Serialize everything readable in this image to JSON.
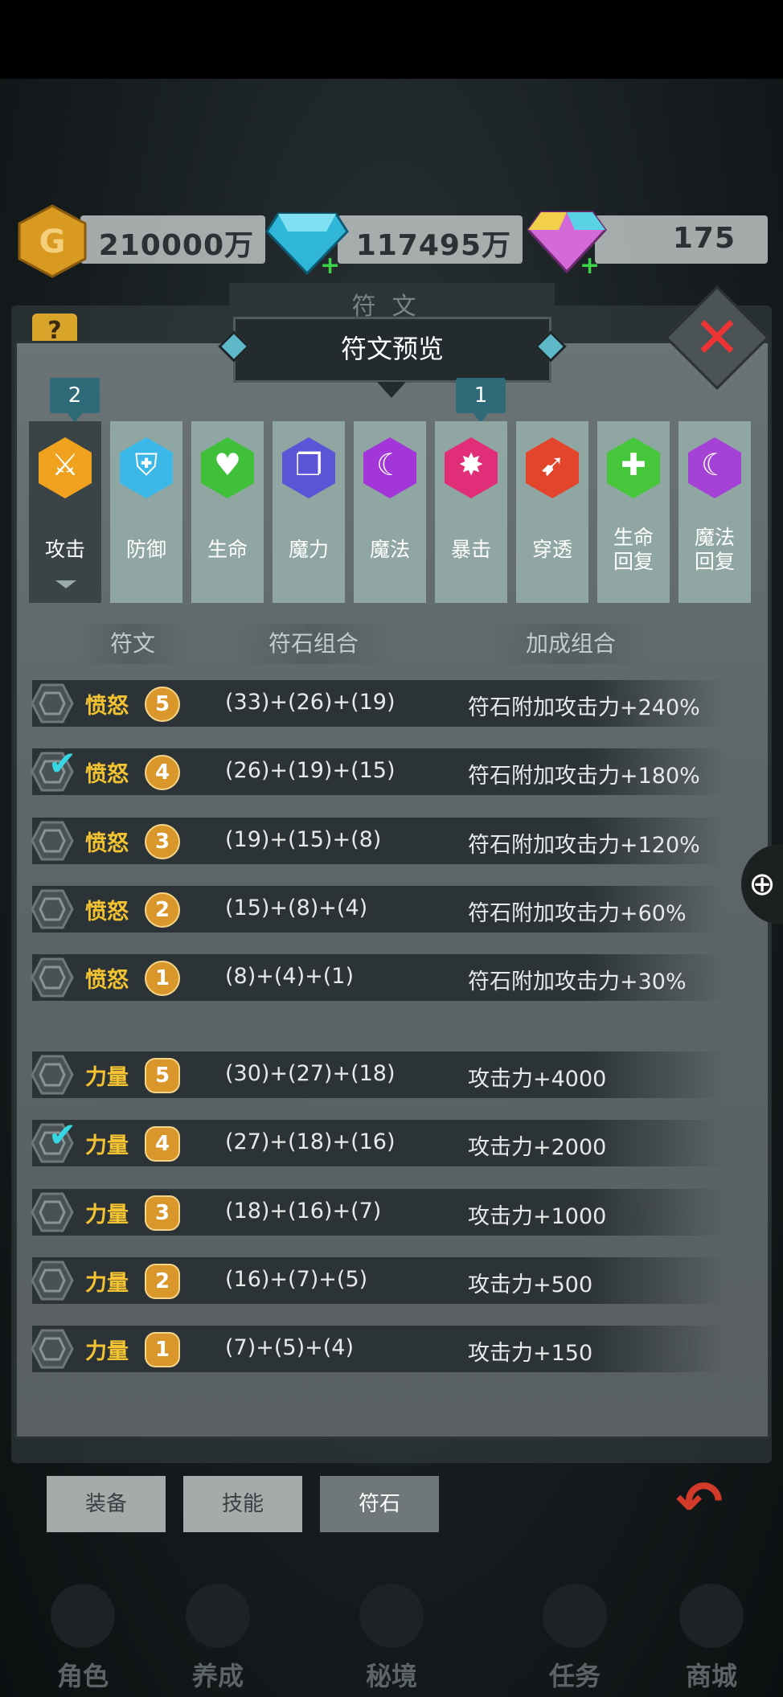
{
  "currency": {
    "gold": "210000万",
    "gems": "117495万",
    "crystals": "175"
  },
  "background": {
    "panel_title": "符文",
    "help": "?"
  },
  "dialog": {
    "title": "符文预览",
    "close_icon": "close-icon"
  },
  "tabs": [
    {
      "label": "攻击",
      "badge": "2",
      "color": "#f0a21e",
      "icon": "sword-icon",
      "glyph": "⚔"
    },
    {
      "label": "防御",
      "badge": "",
      "color": "#3bb8e8",
      "icon": "shield-icon",
      "glyph": "⛨"
    },
    {
      "label": "生命",
      "badge": "",
      "color": "#3fbf3a",
      "icon": "heart-icon",
      "glyph": "♥"
    },
    {
      "label": "魔力",
      "badge": "",
      "color": "#5a55d6",
      "icon": "book-icon",
      "glyph": "❐"
    },
    {
      "label": "魔法",
      "badge": "",
      "color": "#a336d8",
      "icon": "moon-icon",
      "glyph": "☾"
    },
    {
      "label": "暴击",
      "badge": "1",
      "color": "#e02f78",
      "icon": "burst-icon",
      "glyph": "✸"
    },
    {
      "label": "穿透",
      "badge": "",
      "color": "#e2452c",
      "icon": "pierce-icon",
      "glyph": "➹"
    },
    {
      "label": "生命回复",
      "label_line1": "生命",
      "label_line2": "回复",
      "badge": "",
      "color": "#46c63a",
      "icon": "heart-plus-icon",
      "glyph": "✚"
    },
    {
      "label": "魔法回复",
      "label_line1": "魔法",
      "label_line2": "回复",
      "badge": "",
      "color": "#a442d6",
      "icon": "moon-plus-icon",
      "glyph": "☾"
    }
  ],
  "columns": {
    "rune": "符文",
    "combo": "符石组合",
    "bonus": "加成组合"
  },
  "groups": [
    {
      "rows": [
        {
          "name": "愤怒",
          "level": "5",
          "combo": "(33)+(26)+(19)",
          "bonus": "符石附加攻击力+240%",
          "checked": false
        },
        {
          "name": "愤怒",
          "level": "4",
          "combo": "(26)+(19)+(15)",
          "bonus": "符石附加攻击力+180%",
          "checked": true
        },
        {
          "name": "愤怒",
          "level": "3",
          "combo": "(19)+(15)+(8)",
          "bonus": "符石附加攻击力+120%",
          "checked": false
        },
        {
          "name": "愤怒",
          "level": "2",
          "combo": "(15)+(8)+(4)",
          "bonus": "符石附加攻击力+60%",
          "checked": false
        },
        {
          "name": "愤怒",
          "level": "1",
          "combo": "(8)+(4)+(1)",
          "bonus": "符石附加攻击力+30%",
          "checked": false
        }
      ]
    },
    {
      "rows": [
        {
          "name": "力量",
          "level": "5",
          "combo": "(30)+(27)+(18)",
          "bonus": "攻击力+4000",
          "checked": false
        },
        {
          "name": "力量",
          "level": "4",
          "combo": "(27)+(18)+(16)",
          "bonus": "攻击力+2000",
          "checked": true
        },
        {
          "name": "力量",
          "level": "3",
          "combo": "(18)+(16)+(7)",
          "bonus": "攻击力+1000",
          "checked": false
        },
        {
          "name": "力量",
          "level": "2",
          "combo": "(16)+(7)+(5)",
          "bonus": "攻击力+500",
          "checked": false
        },
        {
          "name": "力量",
          "level": "1",
          "combo": "(7)+(5)+(4)",
          "bonus": "攻击力+150",
          "checked": false
        }
      ]
    }
  ],
  "bottom_tabs": [
    {
      "label": "装备"
    },
    {
      "label": "技能"
    },
    {
      "label": "符石",
      "selected": true
    }
  ],
  "nav": [
    {
      "label": "角色"
    },
    {
      "label": "养成"
    },
    {
      "label": "秘境"
    },
    {
      "label": "任务"
    },
    {
      "label": "商城"
    }
  ]
}
